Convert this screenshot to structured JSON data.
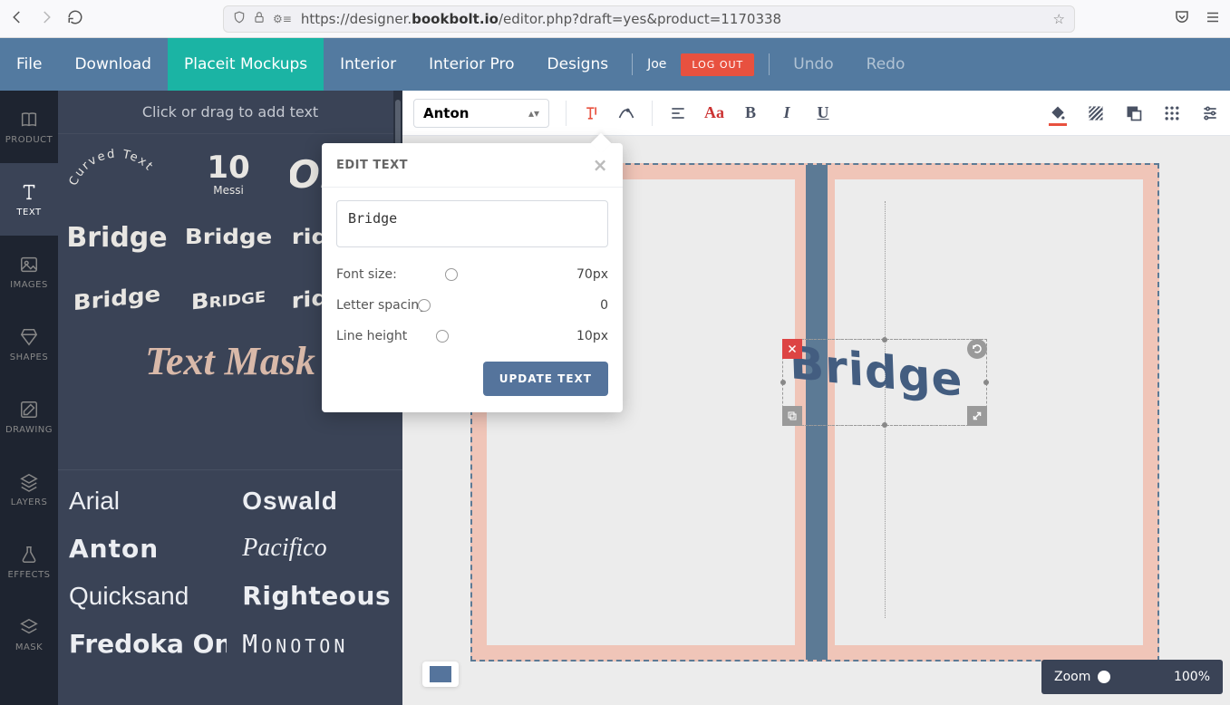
{
  "browser": {
    "url_prefix": "https://designer.",
    "url_bold": "bookbolt.io",
    "url_suffix": "/editor.php?draft=yes&product=1170338"
  },
  "top_nav": {
    "items": [
      "File",
      "Download",
      "Placeit Mockups",
      "Interior",
      "Interior Pro",
      "Designs"
    ],
    "active_index": 2,
    "user": "Joe",
    "logout": "LOG OUT",
    "undo": "Undo",
    "redo": "Redo"
  },
  "rail": {
    "items": [
      {
        "label": "PRODUCT",
        "icon": "book-icon"
      },
      {
        "label": "TEXT",
        "icon": "text-icon"
      },
      {
        "label": "IMAGES",
        "icon": "image-icon"
      },
      {
        "label": "SHAPES",
        "icon": "diamond-icon"
      },
      {
        "label": "DRAWING",
        "icon": "pencil-icon"
      },
      {
        "label": "LAYERS",
        "icon": "layers-icon"
      },
      {
        "label": "EFFECTS",
        "icon": "flask-icon"
      },
      {
        "label": "MASK",
        "icon": "stack-icon"
      }
    ],
    "active_index": 1
  },
  "panel": {
    "header": "Click or drag to add text",
    "styles": {
      "curved": "Curved Text",
      "ten_number": "10",
      "ten_sub": "Messi",
      "ob": "Ob",
      "bridge": "Bridge",
      "mask": "Text Mask"
    },
    "fonts": [
      "Arial",
      "Oswald",
      "Anton",
      "Pacifico",
      "Quicksand",
      "Righteous",
      "Fredoka One",
      "Monoton"
    ]
  },
  "toolbar": {
    "font_name": "Anton",
    "align_icon": "align-left-icon",
    "case_label": "Aa",
    "bold": "B",
    "italic": "I",
    "underline": "U"
  },
  "popover": {
    "title": "EDIT TEXT",
    "text_value": "Bridge",
    "font_size_label": "Font size:",
    "font_size_value": "70px",
    "letter_spacing_label": "Letter spacing",
    "letter_spacing_value": "0",
    "line_height_label": "Line height",
    "line_height_value": "10px",
    "button": "UPDATE TEXT"
  },
  "canvas": {
    "sel_text": "Bridge",
    "accent": "#55749c"
  },
  "zoom": {
    "label": "Zoom",
    "value": "100%"
  }
}
